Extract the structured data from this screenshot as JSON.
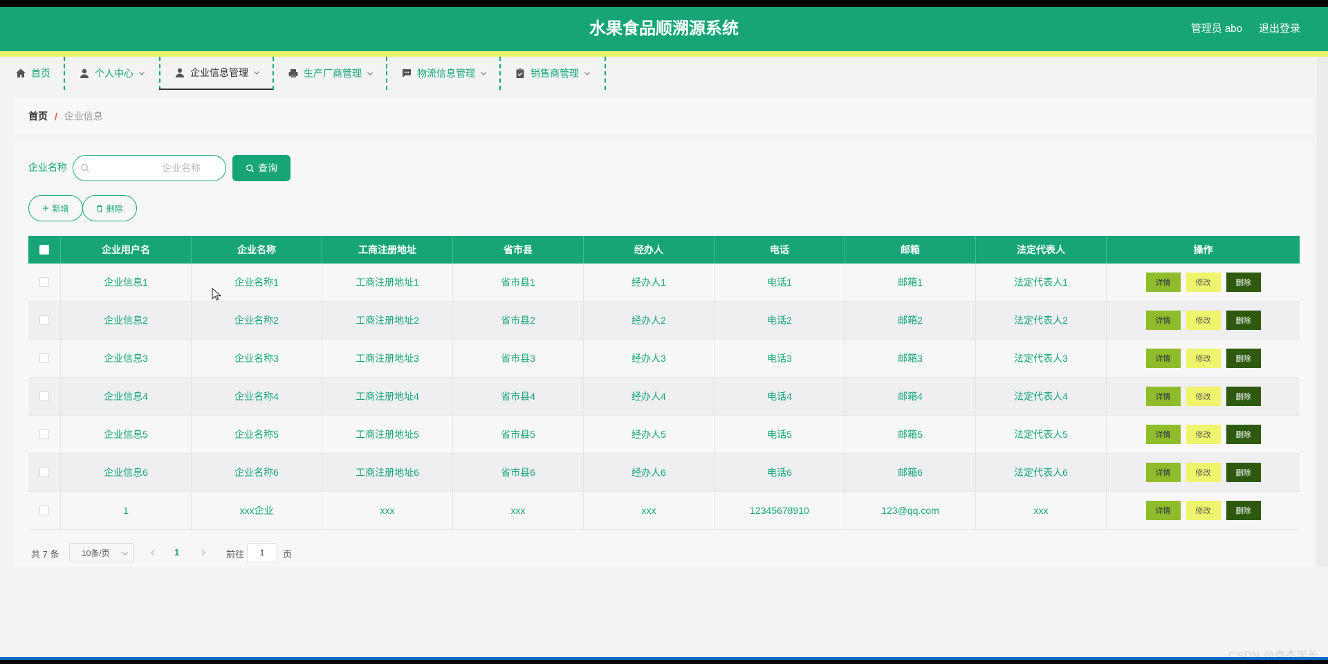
{
  "header": {
    "title": "水果食品顺溯源系统",
    "user": "管理员 abo",
    "logout": "退出登录"
  },
  "nav": {
    "items": [
      {
        "label": "首页",
        "icon": "home-icon"
      },
      {
        "label": "个人中心",
        "icon": "user-icon"
      },
      {
        "label": "企业信息管理",
        "icon": "user-icon"
      },
      {
        "label": "生产厂商管理",
        "icon": "printer-icon"
      },
      {
        "label": "物流信息管理",
        "icon": "chat-icon"
      },
      {
        "label": "销售商管理",
        "icon": "clipboard-icon"
      }
    ]
  },
  "breadcrumb": {
    "home": "首页",
    "separator": "/",
    "current": "企业信息"
  },
  "search": {
    "label": "企业名称",
    "placeholder": "企业名称",
    "button": "查询"
  },
  "actions": {
    "add": "新增",
    "delete": "删除"
  },
  "table": {
    "columns": [
      "企业用户名",
      "企业名称",
      "工商注册地址",
      "省市县",
      "经办人",
      "电话",
      "邮箱",
      "法定代表人",
      "操作"
    ],
    "rows": [
      [
        "企业信息1",
        "企业名称1",
        "工商注册地址1",
        "省市县1",
        "经办人1",
        "电话1",
        "邮箱1",
        "法定代表人1"
      ],
      [
        "企业信息2",
        "企业名称2",
        "工商注册地址2",
        "省市县2",
        "经办人2",
        "电话2",
        "邮箱2",
        "法定代表人2"
      ],
      [
        "企业信息3",
        "企业名称3",
        "工商注册地址3",
        "省市县3",
        "经办人3",
        "电话3",
        "邮箱3",
        "法定代表人3"
      ],
      [
        "企业信息4",
        "企业名称4",
        "工商注册地址4",
        "省市县4",
        "经办人4",
        "电话4",
        "邮箱4",
        "法定代表人4"
      ],
      [
        "企业信息5",
        "企业名称5",
        "工商注册地址5",
        "省市县5",
        "经办人5",
        "电话5",
        "邮箱5",
        "法定代表人5"
      ],
      [
        "企业信息6",
        "企业名称6",
        "工商注册地址6",
        "省市县6",
        "经办人6",
        "电话6",
        "邮箱6",
        "法定代表人6"
      ],
      [
        "1",
        "xxx企业",
        "xxx",
        "xxx",
        "xxx",
        "12345678910",
        "123@qq.com",
        "xxx"
      ]
    ],
    "ops": {
      "detail": "详情",
      "edit": "修改",
      "delete": "删除"
    }
  },
  "pager": {
    "total": "共 7 条",
    "page_size": "10条/页",
    "current_page": "1",
    "goto_label": "前往",
    "goto_value": "1",
    "page_suffix": "页"
  },
  "watermark": "CSDN @卓杰学长",
  "colors": {
    "primary": "#17a577",
    "accent_line": "#e6f56b",
    "detail_btn": "#8fbc2a",
    "edit_btn": "#eef46c",
    "delete_btn": "#2e5a10"
  }
}
